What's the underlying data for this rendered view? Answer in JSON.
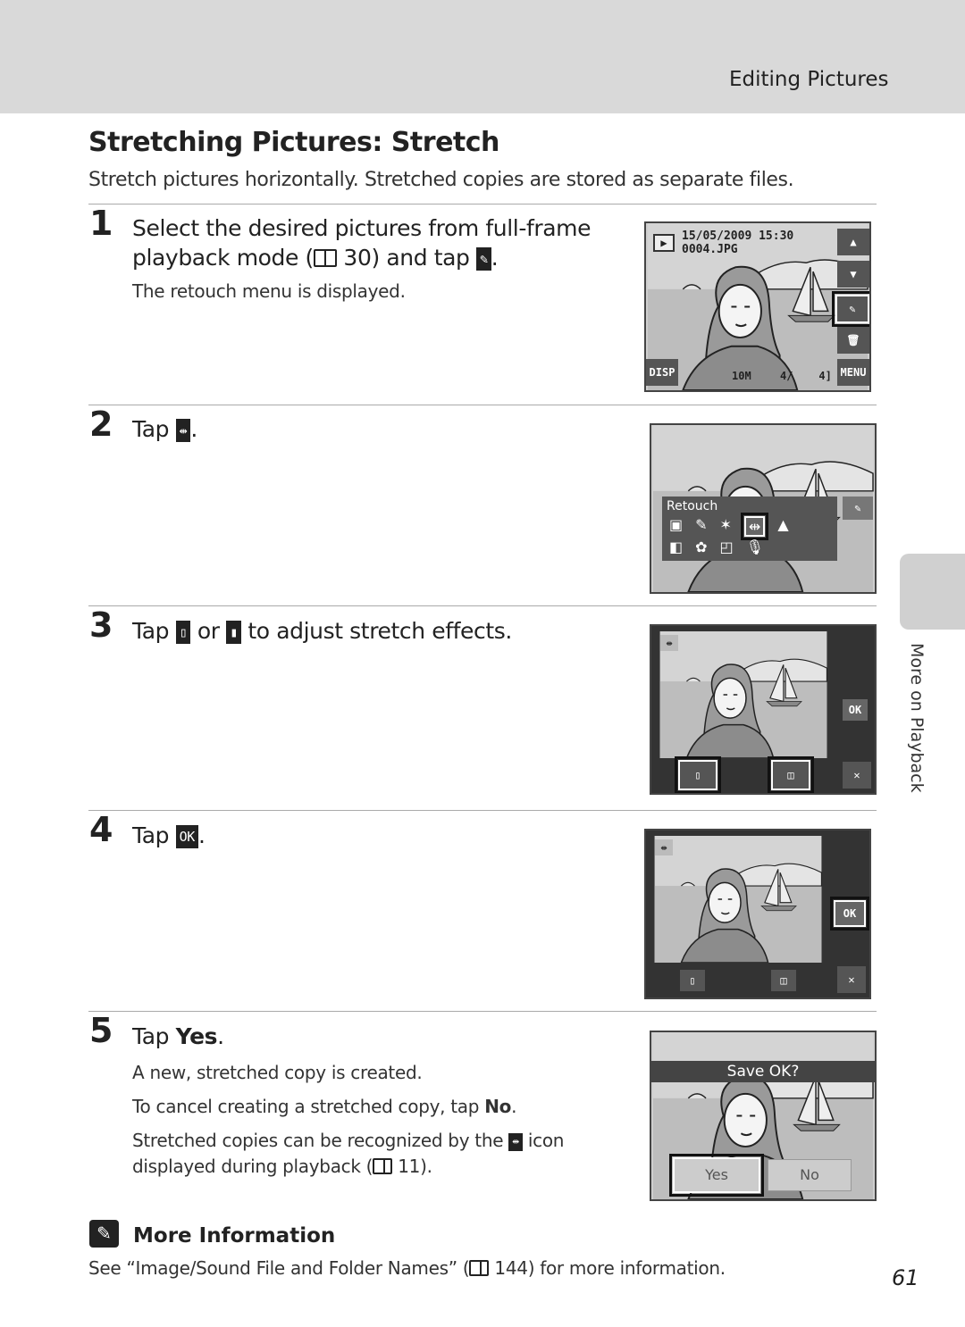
{
  "header": {
    "section": "Editing Pictures"
  },
  "title": "Stretching Pictures: Stretch",
  "subtitle": "Stretch pictures horizontally. Stretched copies are stored as separate files.",
  "steps": [
    {
      "num": "1",
      "line1": "Select the desired pictures from full-frame",
      "line2a": "playback mode (",
      "line2b": " 30) and tap ",
      "line2c": ".",
      "note": "The retouch menu is displayed.",
      "icon": "retouch-icon"
    },
    {
      "num": "2",
      "pre": "Tap ",
      "post": ".",
      "icon": "stretch-icon"
    },
    {
      "num": "3",
      "a": "Tap ",
      "b": " or ",
      "c": " to adjust stretch effects.",
      "icons": [
        "narrow-icon",
        "widen-icon"
      ]
    },
    {
      "num": "4",
      "pre": "Tap ",
      "post": ".",
      "icon_label": "OK"
    },
    {
      "num": "5",
      "pre": "Tap ",
      "bold": "Yes",
      "post": ".",
      "notes": [
        "A new, stretched copy is created."
      ],
      "cancel_a": "To cancel creating a stretched copy, tap ",
      "cancel_b": "No",
      "cancel_c": ".",
      "rec_a": "Stretched copies can be recognized by the ",
      "rec_b": " icon",
      "rec_c": "displayed during playback (",
      "rec_d": " 11)."
    }
  ],
  "screens": {
    "s1": {
      "date": "15/05/2009 15:30",
      "file": "0004.JPG",
      "disp": "DISP",
      "menu": "MENU",
      "counter": "4/    4]",
      "size": "10M"
    },
    "s2": {
      "menu_title": "Retouch"
    },
    "s3": {
      "ok": "OK"
    },
    "s4": {
      "ok": "OK"
    },
    "s5": {
      "prompt": "Save OK?",
      "yes": "Yes",
      "no": "No"
    }
  },
  "more_info": {
    "title": "More Information",
    "text_a": "See “Image/Sound File and Folder Names” (",
    "text_b": " 144) for more information."
  },
  "side_tab": "More on Playback",
  "page_number": "61"
}
